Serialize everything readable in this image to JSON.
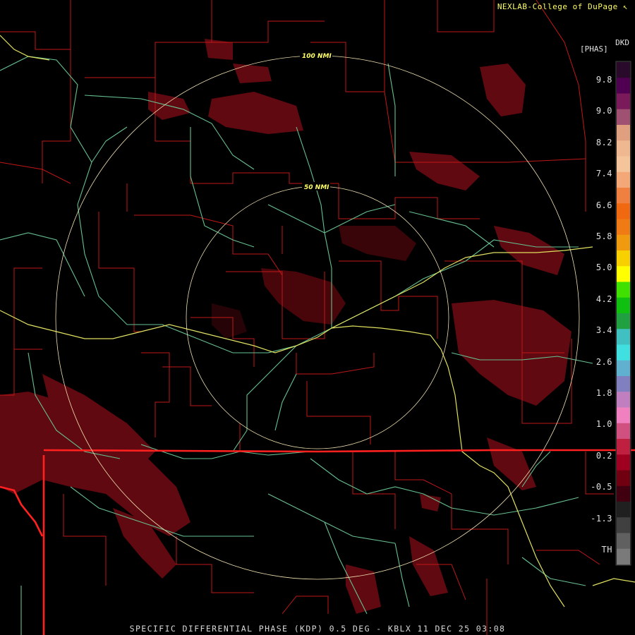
{
  "credit": "NEXLAB-College of DuPage ↖",
  "product_caption": "SPECIFIC DIFFERENTIAL PHASE (KDP) 0.5 DEG - KBLX 11 DEC 25 03:08",
  "rings": [
    "100 NMI",
    "50 NMI"
  ],
  "legend": {
    "unit_top": "DKD",
    "unit_sub": "[PHAS]",
    "ticks": [
      "9.8",
      "9.0",
      "8.2",
      "7.4",
      "6.6",
      "5.8",
      "5.0",
      "4.2",
      "3.4",
      "2.6",
      "1.8",
      "1.0",
      "0.2",
      "-0.5",
      "-1.3",
      "TH"
    ],
    "colors": [
      "#2a0a2a",
      "#500050",
      "#7a1a5a",
      "#a05070",
      "#e0a080",
      "#f0b890",
      "#f4c49a",
      "#f4a878",
      "#f08040",
      "#f06810",
      "#f07a14",
      "#f09a10",
      "#f8d000",
      "#ffff00",
      "#40e000",
      "#10c010",
      "#20a040",
      "#40c0c0",
      "#40e0e0",
      "#60b0d0",
      "#8080c0",
      "#c080c0",
      "#f080c0",
      "#d05080",
      "#c02040",
      "#a00020",
      "#700010",
      "#400010",
      "#202020",
      "#404040",
      "#606060",
      "#7a7a7a"
    ]
  }
}
